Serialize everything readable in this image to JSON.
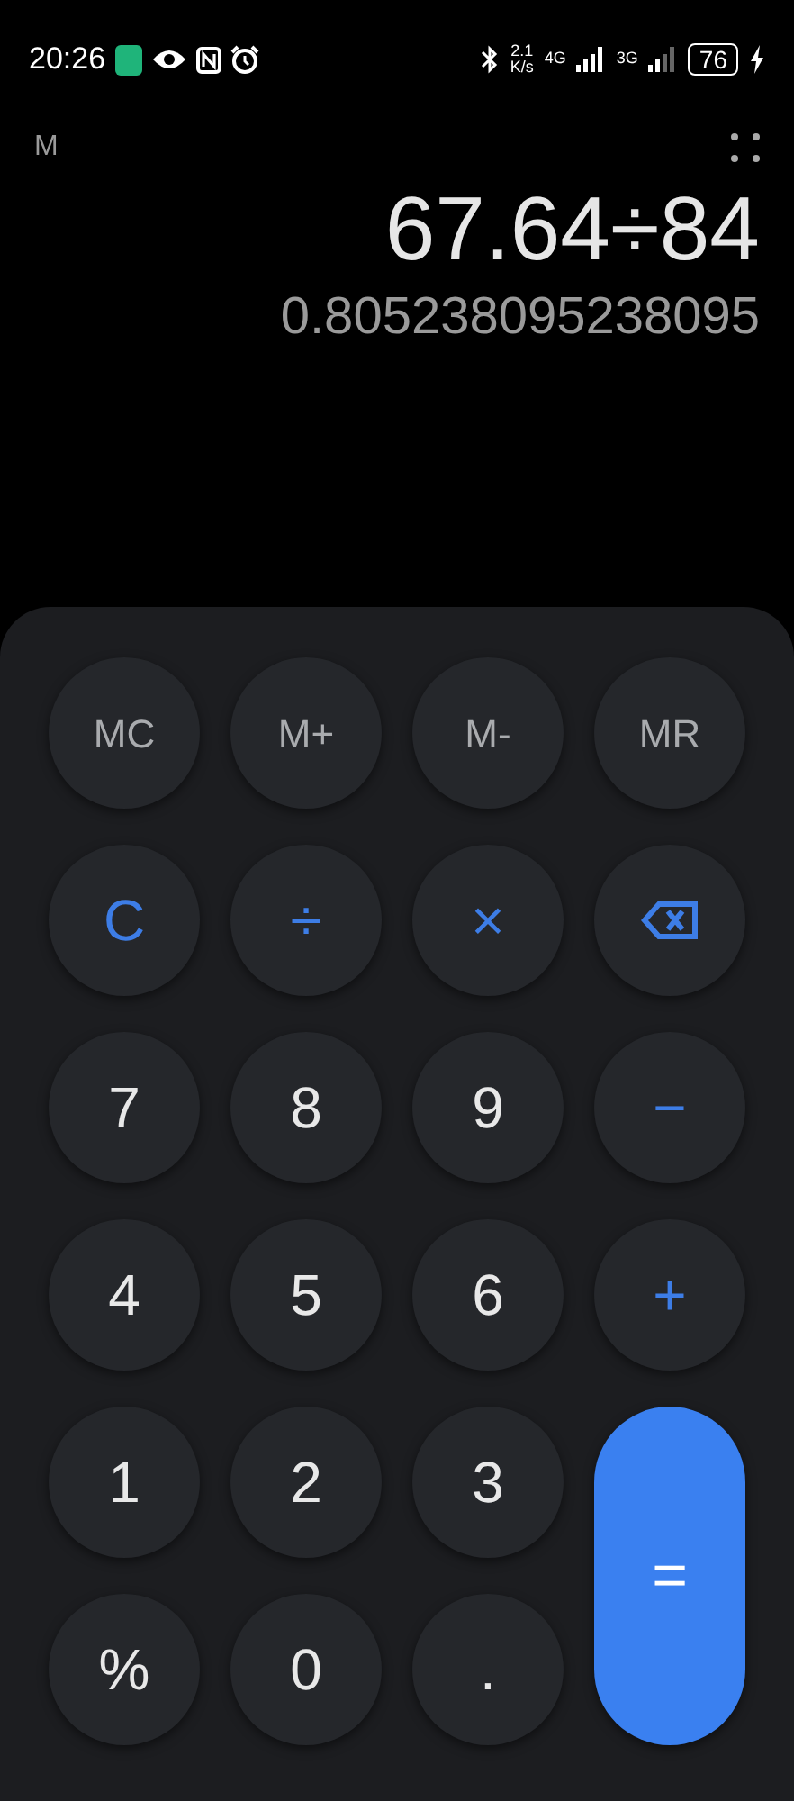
{
  "status_bar": {
    "time": "20:26",
    "net_speed": "2.1",
    "net_speed_unit": "K/s",
    "network_1": "4G",
    "network_2": "3G",
    "battery": "76"
  },
  "header": {
    "memory_indicator": "M"
  },
  "display": {
    "expression": "67.64÷84",
    "result": "0.805238095238095"
  },
  "keys": [
    {
      "kind": "memory",
      "label": "MC"
    },
    {
      "kind": "memory",
      "label": "M+"
    },
    {
      "kind": "memory",
      "label": "M-"
    },
    {
      "kind": "memory",
      "label": "MR"
    },
    {
      "kind": "operator",
      "label": "C"
    },
    {
      "kind": "operator",
      "label": "÷"
    },
    {
      "kind": "operator",
      "label": "×"
    },
    {
      "kind": "backspace"
    },
    {
      "kind": "digit",
      "label": "7"
    },
    {
      "kind": "digit",
      "label": "8"
    },
    {
      "kind": "digit",
      "label": "9"
    },
    {
      "kind": "operator",
      "label": "−"
    },
    {
      "kind": "digit",
      "label": "4"
    },
    {
      "kind": "digit",
      "label": "5"
    },
    {
      "kind": "digit",
      "label": "6"
    },
    {
      "kind": "operator",
      "label": "+"
    },
    {
      "kind": "digit",
      "label": "1"
    },
    {
      "kind": "digit",
      "label": "2"
    },
    {
      "kind": "digit",
      "label": "3"
    },
    {
      "kind": "equals",
      "label": "="
    },
    {
      "kind": "digit",
      "label": "%"
    },
    {
      "kind": "digit",
      "label": "0"
    },
    {
      "kind": "digit",
      "label": "."
    }
  ]
}
